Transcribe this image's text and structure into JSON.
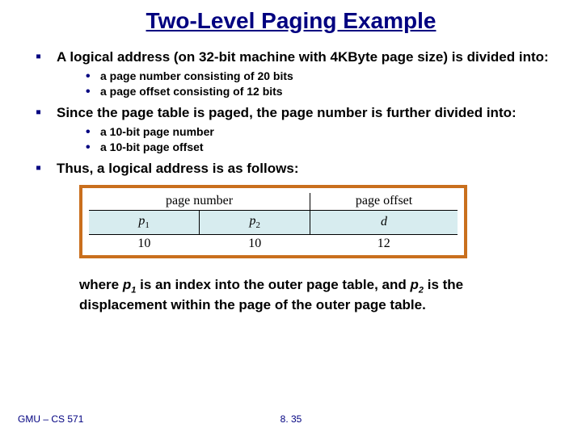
{
  "title": "Two-Level Paging Example",
  "bullets": {
    "b1": "A logical address (on 32-bit machine with 4KByte page size) is divided into:",
    "b1a": "a page number consisting of 20 bits",
    "b1b": "a page offset consisting of 12 bits",
    "b2": "Since the page table is paged, the page number is further divided into:",
    "b2a": "a 10-bit page number",
    "b2b": "a 10-bit page offset",
    "b3": "Thus, a logical address is as follows:"
  },
  "diagram": {
    "hdr_pn": "page number",
    "hdr_po": "page offset",
    "p1": "p",
    "p1_sub": "1",
    "p2": "p",
    "p2_sub": "2",
    "d": "d",
    "bits_p1": "10",
    "bits_p2": "10",
    "bits_d": "12"
  },
  "caption_pre": "where ",
  "caption_p1": "p",
  "caption_p1_sub": "1",
  "caption_mid1": " is an index into the outer page table, and ",
  "caption_p2": "p",
  "caption_p2_sub": "2",
  "caption_mid2": " is the displacement within the page of the outer page table.",
  "footer_left": "GMU – CS 571",
  "footer_center": "8. 35"
}
